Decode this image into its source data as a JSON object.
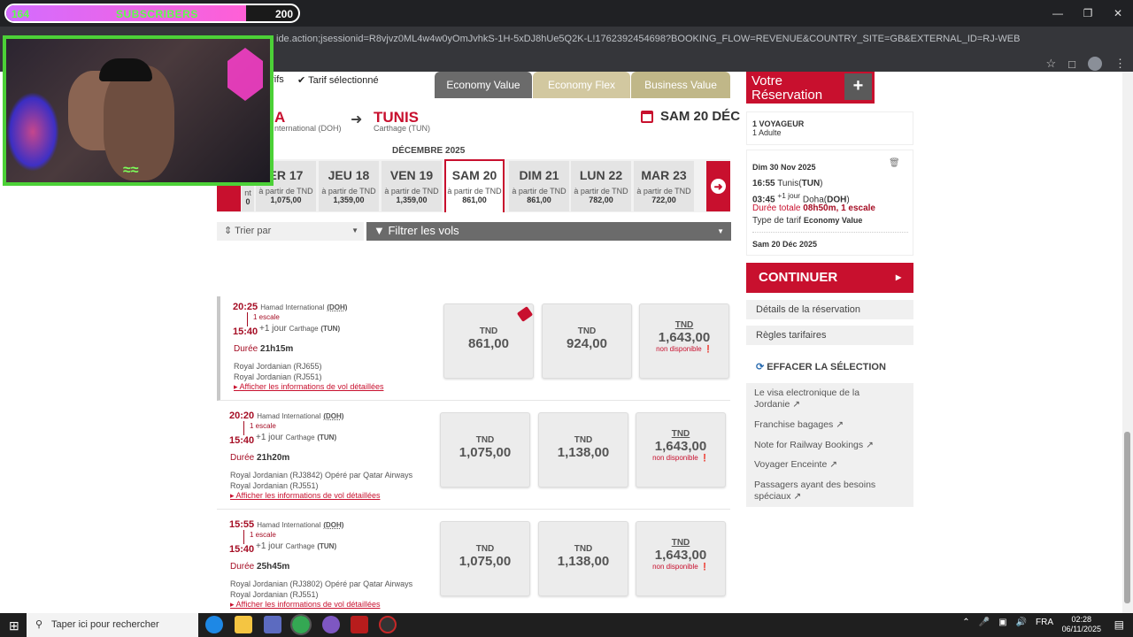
{
  "browser": {
    "url": "ide.action;jsessionid=R8vjvz0ML4w4w0yOmJvhkS-1H-5xDJ8hUe5Q2K-L!1762392454698?BOOKING_FLOW=REVENUE&COUNTRY_SITE=GB&EXTERNAL_ID=RJ-WEB&LANGUAGE=FR&OFFICE_ID=AMMRJ08..."
  },
  "overlay": {
    "sub_left": "164",
    "sub_label": "SUBSCRIBERS",
    "sub_right": "200",
    "sub_progress": 0.82
  },
  "header": {
    "tarifs": "arifs",
    "tarif_selected": "Tarif sélectionné",
    "fare_tabs": [
      "Economy Value",
      "Economy Flex",
      "Business Value"
    ],
    "origin_code": "A",
    "origin_airport": "nternational (DOH)",
    "destination": "TUNIS",
    "destination_airport": "Carthage (TUN)",
    "date": "SAM 20 DÉC"
  },
  "calendar": {
    "month": "DÉCEMBRE 2025",
    "from_label": "à partir de TND",
    "first_partial_label": "nt",
    "first_partial_price": "0",
    "days": [
      {
        "day": "ER 17",
        "price": "1,075,00"
      },
      {
        "day": "JEU 18",
        "price": "1,359,00"
      },
      {
        "day": "VEN 19",
        "price": "1,359,00"
      },
      {
        "day": "SAM 20",
        "price": "861,00"
      },
      {
        "day": "DIM 21",
        "price": "861,00"
      },
      {
        "day": "LUN 22",
        "price": "782,00"
      },
      {
        "day": "MAR 23",
        "price": "722,00"
      }
    ]
  },
  "filters": {
    "sort_label": "Trier par",
    "filter_label": "Filtrer les vols"
  },
  "flights": [
    {
      "dep_time": "20:25",
      "dep_airport": "Hamad International",
      "dep_code": "(DOH)",
      "stops": "1 escale",
      "arr_time": "15:40",
      "next_day": "+1 jour",
      "arr_airport": "Carthage",
      "arr_code": "(TUN)",
      "duration_label": "Durée",
      "duration": "21h15m",
      "op1": "Royal Jordanian (RJ655)",
      "op2": "Royal Jordanian (RJ551)",
      "link": "Afficher les informations de vol détaillées",
      "prices": [
        "861,00",
        "924,00",
        "1,643,00"
      ]
    },
    {
      "dep_time": "20:20",
      "dep_airport": "Hamad International",
      "dep_code": "(DOH)",
      "stops": "1 escale",
      "arr_time": "15:40",
      "next_day": "+1 jour",
      "arr_airport": "Carthage",
      "arr_code": "(TUN)",
      "duration_label": "Durée",
      "duration": "21h20m",
      "op1": "Royal Jordanian (RJ3842) Opéré par Qatar Airways",
      "op2": "Royal Jordanian (RJ551)",
      "link": "Afficher les informations de vol détaillées",
      "prices": [
        "1,075,00",
        "1,138,00",
        "1,643,00"
      ]
    },
    {
      "dep_time": "15:55",
      "dep_airport": "Hamad International",
      "dep_code": "(DOH)",
      "stops": "1 escale",
      "arr_time": "15:40",
      "next_day": "+1 jour",
      "arr_airport": "Carthage",
      "arr_code": "(TUN)",
      "duration_label": "Durée",
      "duration": "25h45m",
      "op1": "Royal Jordanian (RJ3802) Opéré par Qatar Airways",
      "op2": "Royal Jordanian (RJ551)",
      "link": "Afficher les informations de vol détaillées",
      "prices": [
        "1,075,00",
        "1,138,00",
        "1,643,00"
      ]
    }
  ],
  "currency": "TND",
  "unavailable": "non disponible",
  "reservation": {
    "title_line1": "Votre",
    "title_line2": "Réservation",
    "voyageur": "1 VOYAGEUR",
    "adulte": "1 Adulte",
    "date1": "Dim 30 Nov 2025",
    "dep_time": "16:55",
    "dep_city": "Tunis(",
    "dep_code": "TUN",
    "arr_time": "03:45",
    "arr_plus": "+1 jour",
    "arr_city": "Doha(",
    "arr_code": "DOH",
    "duration_label": "Durée totale",
    "duration_value": "08h50m, 1 escale",
    "fare_type_label": "Type de tarif",
    "fare_type_value": "Economy Value",
    "date2": "Sam 20 Déc 2025",
    "continue_label": "CONTINUER",
    "details_label": "Détails de la réservation",
    "rules_label": "Règles tarifaires",
    "clear_label": "EFFACER LA SÉLECTION",
    "links": [
      "Le visa electronique de la Jordanie",
      "Franchise bagages",
      "Note for Railway Bookings",
      "Voyager Enceinte",
      "Passagers ayant des besoins spéciaux"
    ]
  },
  "taskbar": {
    "search_placeholder": "Taper ici pour rechercher",
    "lang": "FRA",
    "time": "02:28",
    "date": "06/11/2025"
  },
  "colors": {
    "brand": "#c8102e",
    "economy_value_tab": "#6b6b6b",
    "economy_flex_tab": "#d2c8a0",
    "business_tab": "#c0b788",
    "webcam_border": "#4cd137"
  }
}
